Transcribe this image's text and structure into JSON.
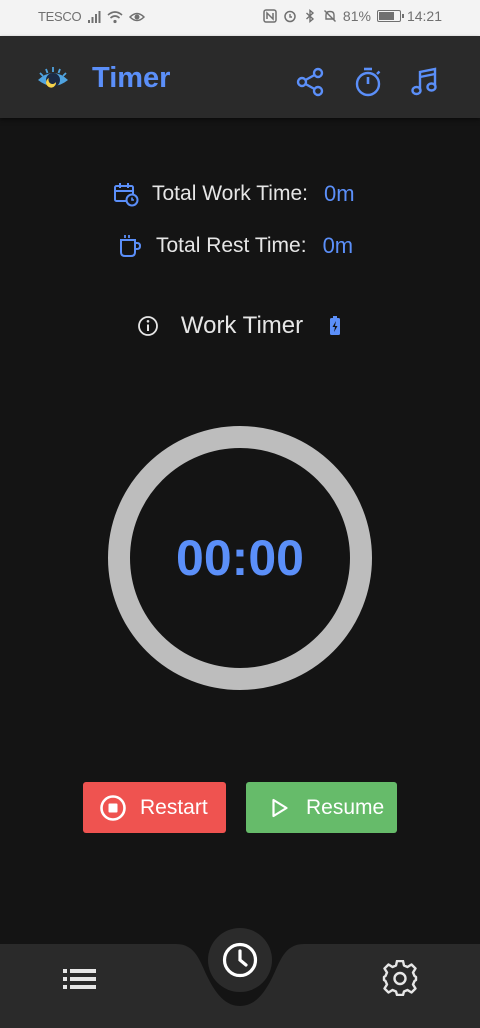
{
  "status_bar": {
    "carrier": "TESCO",
    "battery": "81%",
    "battery_level": 0.81,
    "time": "14:21",
    "icons": [
      "signal-icon",
      "wifi-icon",
      "eye-icon",
      "nfc-icon",
      "alarm-icon",
      "bluetooth-icon",
      "mute-icon",
      "battery-icon"
    ]
  },
  "app_bar": {
    "title": "Timer",
    "actions": [
      "share-icon",
      "stopwatch-icon",
      "music-icon"
    ]
  },
  "totals": {
    "work_label": "Total Work Time:",
    "work_value": "0m",
    "rest_label": "Total Rest Time:",
    "rest_value": "0m"
  },
  "timer": {
    "mode_label": "Work Timer",
    "time": "00:00",
    "progress": 0
  },
  "buttons": {
    "restart": "Restart",
    "resume": "Resume"
  },
  "bottom_nav": {
    "items": [
      "list-icon",
      "clock-icon",
      "settings-icon"
    ]
  },
  "colors": {
    "accent": "#5b8ff9",
    "restart": "#ef5350",
    "resume": "#66bb6a",
    "ring": "#bdbdbd",
    "background": "#141414",
    "bar": "#2a2a2a"
  }
}
